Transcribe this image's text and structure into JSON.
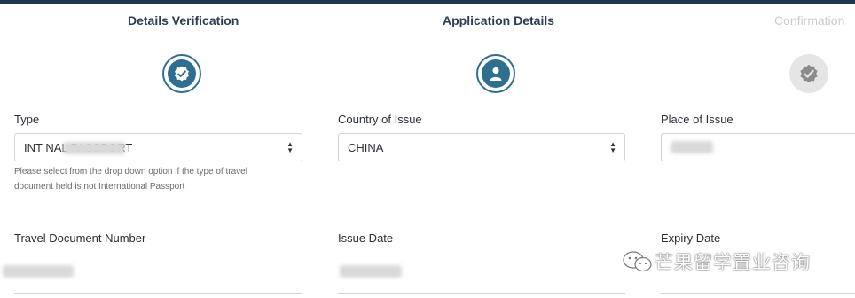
{
  "steps": [
    {
      "label": "Details Verification",
      "state": "done",
      "icon": "badge-check-icon"
    },
    {
      "label": "Application Details",
      "state": "current",
      "icon": "user-icon"
    },
    {
      "label": "Confirmation",
      "state": "pending",
      "icon": "badge-check-icon"
    }
  ],
  "form": {
    "type": {
      "label": "Type",
      "value": "INT                  NAL PASSPORT",
      "hint_line1": "Please select from the drop down option if the type of travel",
      "hint_line2": "document held is not International Passport"
    },
    "country_of_issue": {
      "label": "Country of Issue",
      "value": "CHINA"
    },
    "place_of_issue": {
      "label": "Place of Issue"
    },
    "travel_document_number": {
      "label": "Travel Document Number"
    },
    "issue_date": {
      "label": "Issue Date"
    },
    "expiry_date": {
      "label": "Expiry Date"
    }
  },
  "watermark": {
    "text": "芒果留学置业咨询",
    "icon": "wechat-icon"
  },
  "colors": {
    "active": "#2f6e8f",
    "title": "#2c3e56",
    "dim": "#c8ccd1",
    "topbar": "#1f3550"
  }
}
